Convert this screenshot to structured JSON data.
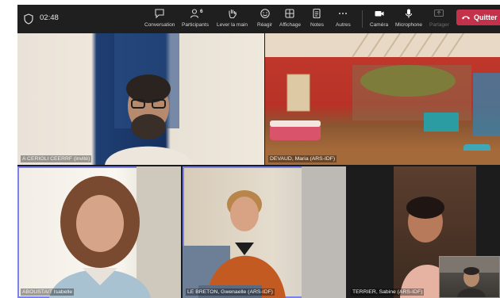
{
  "meeting": {
    "timer": "02:48"
  },
  "toolbar": {
    "conversation": "Conversation",
    "participants": "Participants",
    "participants_count": "6",
    "raise_hand": "Lever la main",
    "react": "Réagir",
    "view": "Affichage",
    "notes": "Notes",
    "more": "Autres",
    "camera": "Caméra",
    "microphone": "Microphone",
    "share": "Partager",
    "leave": "Quitter"
  },
  "participants": [
    {
      "name": "A CERIOLI CEERRF (invité)"
    },
    {
      "name": "DEVAUD, Maria (ARS-IDF)"
    },
    {
      "name": "ABOUSTAIT Isabelle"
    },
    {
      "name": "LE BRETON, Gwenaelle (ARS-IDF)"
    },
    {
      "name": "TERRIER, Sabine (ARS-IDF)"
    }
  ],
  "colors": {
    "toolbar_bg": "#1f1f1f",
    "leave_red": "#c4314b",
    "speaking_outline": "#7b83eb"
  }
}
